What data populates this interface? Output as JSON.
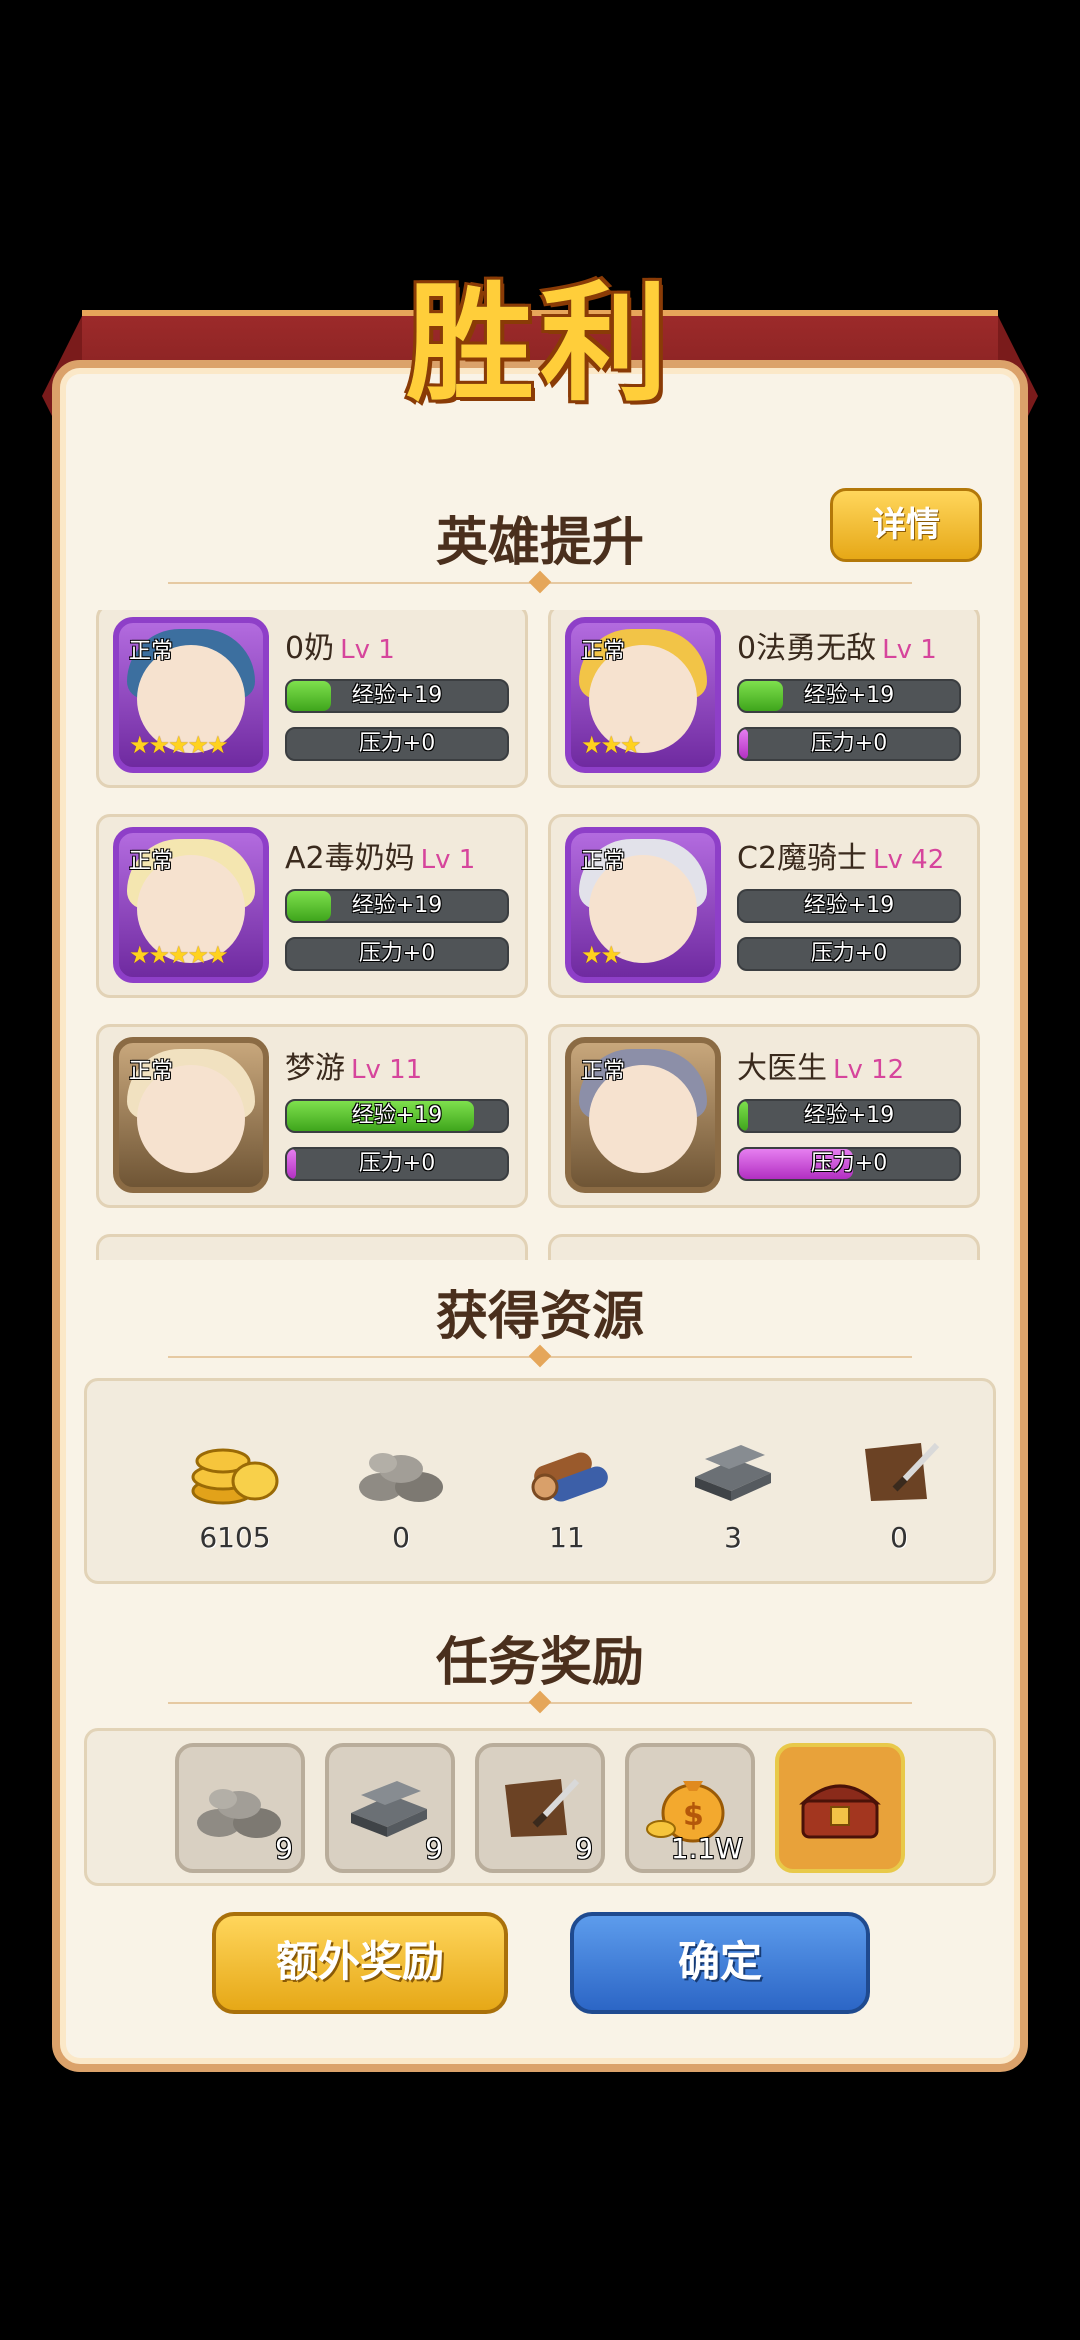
{
  "title": "胜利",
  "hero_section": {
    "title": "英雄提升",
    "detail_button": "详情",
    "heroes": [
      {
        "name": "0奶",
        "level": "Lv 1",
        "status": "正常",
        "stars": "★★★★★",
        "exp": "经验+19",
        "pressure": "压力+0",
        "exp_fill": 0.2,
        "pressure_fill": 0.0
      },
      {
        "name": "0法勇无敌",
        "level": "Lv 1",
        "status": "正常",
        "stars": "★★★",
        "exp": "经验+19",
        "pressure": "压力+0",
        "exp_fill": 0.2,
        "pressure_fill": 0.04
      },
      {
        "name": "A2毒奶妈",
        "level": "Lv 1",
        "status": "正常",
        "stars": "★★★★★",
        "exp": "经验+19",
        "pressure": "压力+0",
        "exp_fill": 0.2,
        "pressure_fill": 0.0
      },
      {
        "name": "C2魔骑士",
        "level": "Lv 42",
        "status": "正常",
        "stars": "★★",
        "exp": "经验+19",
        "pressure": "压力+0",
        "exp_fill": 0.0,
        "pressure_fill": 0.0
      },
      {
        "name": "梦游",
        "level": "Lv 11",
        "status": "正常",
        "stars": "",
        "exp": "经验+19",
        "pressure": "压力+0",
        "exp_fill": 0.85,
        "pressure_fill": 0.04
      },
      {
        "name": "大医生",
        "level": "Lv 12",
        "status": "正常",
        "stars": "",
        "exp": "经验+19",
        "pressure": "压力+0",
        "exp_fill": 0.04,
        "pressure_fill": 0.52
      }
    ]
  },
  "resources": {
    "title": "获得资源",
    "items": [
      {
        "icon": "gold-coins-icon",
        "value": "6105"
      },
      {
        "icon": "stone-icon",
        "value": "0"
      },
      {
        "icon": "wood-icon",
        "value": "11"
      },
      {
        "icon": "iron-icon",
        "value": "3"
      },
      {
        "icon": "leather-icon",
        "value": "0"
      }
    ]
  },
  "task_rewards": {
    "title": "任务奖励",
    "items": [
      {
        "icon": "stone-icon",
        "count": "9"
      },
      {
        "icon": "iron-icon",
        "count": "9"
      },
      {
        "icon": "leather-icon",
        "count": "9"
      },
      {
        "icon": "money-bag-icon",
        "count": "1.1W"
      },
      {
        "icon": "treasure-chest-icon",
        "count": ""
      }
    ]
  },
  "buttons": {
    "extra": "额外奖励",
    "confirm": "确定"
  },
  "colors": {
    "accent_gold": "#ffce3a",
    "confirm_blue": "#2c66c6",
    "level_pink": "#d6459c"
  }
}
